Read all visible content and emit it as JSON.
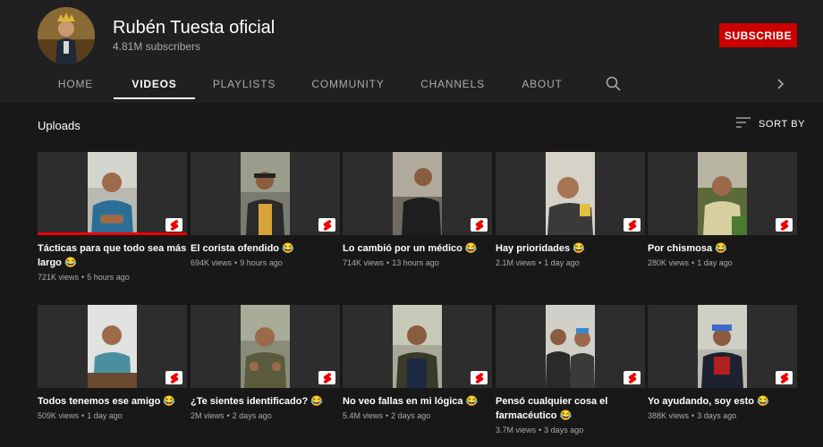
{
  "channel": {
    "name": "Rubén Tuesta oficial",
    "subscribers": "4.81M subscribers",
    "subscribe_label": "SUBSCRIBE"
  },
  "tabs": [
    {
      "label": "HOME"
    },
    {
      "label": "VIDEOS"
    },
    {
      "label": "PLAYLISTS"
    },
    {
      "label": "COMMUNITY"
    },
    {
      "label": "CHANNELS"
    },
    {
      "label": "ABOUT"
    }
  ],
  "active_tab": "VIDEOS",
  "section": {
    "title": "Uploads",
    "sort_label": "SORT BY"
  },
  "videos": [
    {
      "title": "Tácticas para que todo sea más largo 😂",
      "views": "721K views",
      "age": "5 hours ago",
      "watched": 1.0
    },
    {
      "title": "El corista ofendido 😂",
      "views": "694K views",
      "age": "9 hours ago"
    },
    {
      "title": "Lo cambió por un médico 😂",
      "views": "714K views",
      "age": "13 hours ago"
    },
    {
      "title": "Hay prioridades 😂",
      "views": "2.1M views",
      "age": "1 day ago"
    },
    {
      "title": "Por chismosa 😂",
      "views": "280K views",
      "age": "1 day ago"
    },
    {
      "title": "Todos tenemos ese amigo 😂",
      "views": "509K views",
      "age": "1 day ago"
    },
    {
      "title": "¿Te sientes identificado? 😂",
      "views": "2M views",
      "age": "2 days ago"
    },
    {
      "title": "No veo fallas en mi lógica 😂",
      "views": "5.4M views",
      "age": "2 days ago"
    },
    {
      "title": "Pensó cualquier cosa el farmacéutico 😂",
      "views": "3.7M views",
      "age": "3 days ago"
    },
    {
      "title": "Yo ayudando, soy esto 😂",
      "views": "388K views",
      "age": "3 days ago"
    }
  ],
  "colors": {
    "background": "#181818",
    "header": "#202020",
    "subscribe": "#cc0000",
    "progress": "#ee0000"
  },
  "icons": [
    "search-icon",
    "chevron-right-icon",
    "sort-icon",
    "shorts-icon"
  ]
}
